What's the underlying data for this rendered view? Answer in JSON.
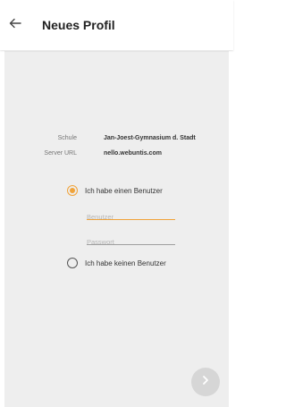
{
  "header": {
    "title": "Neues Profil",
    "back_icon": "arrow-left-icon"
  },
  "info": {
    "school_label": "Schule",
    "school_value": "Jan-Joest-Gymnasium d. Stadt",
    "server_label": "Server URL",
    "server_value": "nello.webuntis.com"
  },
  "login_options": {
    "with_user_label": "Ich habe einen Benutzer",
    "with_user_selected": true,
    "username_placeholder": "Benutzer",
    "password_placeholder": "Passwort",
    "without_user_label": "Ich habe keinen Benutzer",
    "without_user_selected": false
  },
  "fab": {
    "icon": "chevron-right-icon"
  },
  "colors": {
    "accent": "#f0a33a",
    "background": "#eeeeee",
    "fab": "#d6d6d6"
  }
}
